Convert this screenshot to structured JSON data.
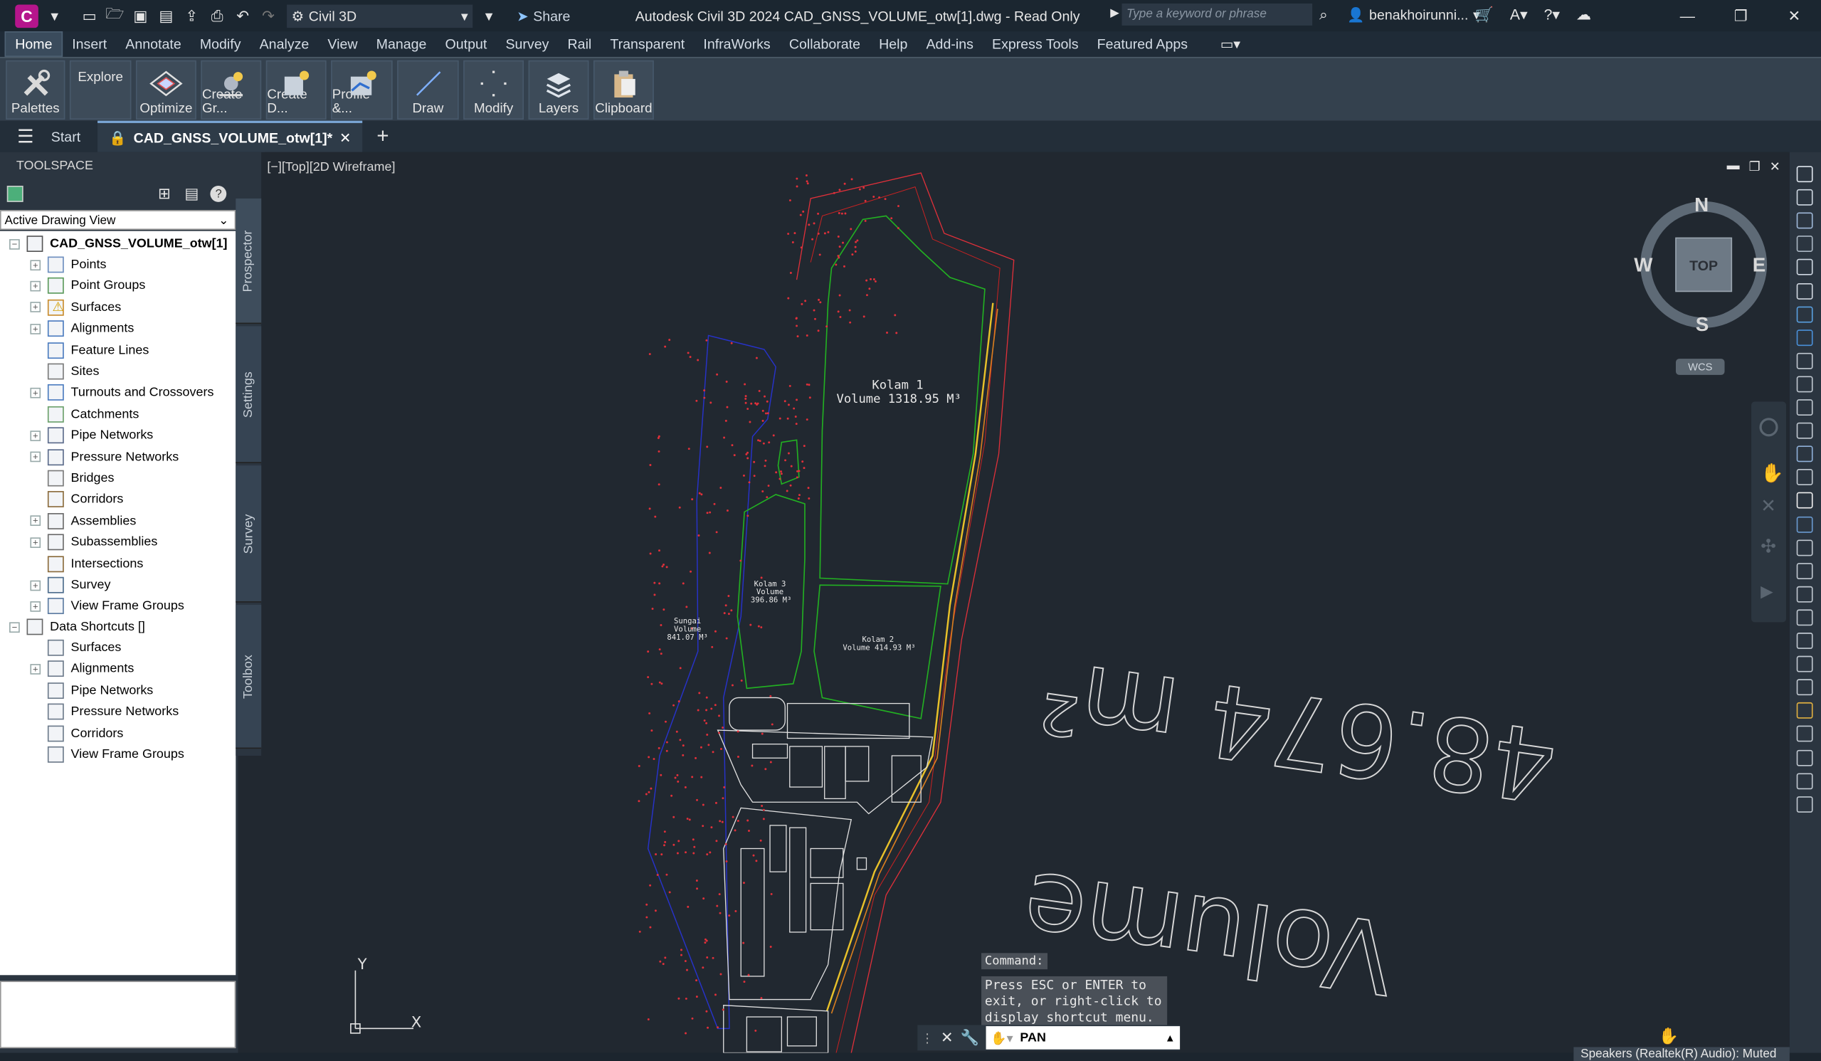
{
  "window": {
    "title": "Autodesk Civil 3D 2024   CAD_GNSS_VOLUME_otw[1].dwg - Read Only",
    "app_letter": "C",
    "workspace": "Civil 3D",
    "share_label": "Share",
    "search_placeholder": "Type a keyword or phrase",
    "user": "benakhoirunni...",
    "accent_color": "#b5158c"
  },
  "ribbon": {
    "tabs": [
      "Home",
      "Insert",
      "Annotate",
      "Modify",
      "Analyze",
      "View",
      "Manage",
      "Output",
      "Survey",
      "Rail",
      "Transparent",
      "InfraWorks",
      "Collaborate",
      "Help",
      "Add-ins",
      "Express Tools",
      "Featured Apps"
    ],
    "active_tab": "Home",
    "buttons": [
      "Palettes",
      "Explore",
      "Optimize",
      "Create Gr...",
      "Create D...",
      "Profile &...",
      "Draw",
      "Modify",
      "Layers",
      "Clipboard"
    ]
  },
  "filetabs": {
    "start": "Start",
    "file": "CAD_GNSS_VOLUME_otw[1]*"
  },
  "toolspace": {
    "title": "TOOLSPACE",
    "view_select": "Active Drawing View",
    "root": "CAD_GNSS_VOLUME_otw[1]",
    "items": [
      "Points",
      "Point Groups",
      "Surfaces",
      "Alignments",
      "Feature Lines",
      "Sites",
      "Turnouts and Crossovers",
      "Catchments",
      "Pipe Networks",
      "Pressure Networks",
      "Bridges",
      "Corridors",
      "Assemblies",
      "Subassemblies",
      "Intersections",
      "Survey",
      "View Frame Groups"
    ],
    "shortcuts_root": "Data Shortcuts []",
    "shortcut_items": [
      "Surfaces",
      "Alignments",
      "Pipe Networks",
      "Pressure Networks",
      "Corridors",
      "View Frame Groups"
    ],
    "side_tabs": [
      "Prospector",
      "Settings",
      "Survey",
      "Toolbox"
    ]
  },
  "viewport": {
    "label": "[−][Top][2D Wireframe]",
    "compass": {
      "n": "N",
      "s": "S",
      "e": "E",
      "w": "W",
      "top": "TOP"
    },
    "wcs": "WCS",
    "kolam1_name": "Kolam 1",
    "kolam1_volume": "Volume 1318.95 M³",
    "kolam2_name": "Kolam 2",
    "kolam2_volume": "Volume 414.93 M³",
    "kolam3_name": "Kolam 3",
    "kolam3_label": "Volume",
    "kolam3_volume": "396.86 M³",
    "sungai_name": "Sungai",
    "sungai_label": "Volume",
    "sungai_volume": "841.07 M³",
    "mirror_text_1": "48.674 m²",
    "mirror_text_2": "Volume",
    "axis_x": "X",
    "axis_y": "Y"
  },
  "command": {
    "label": "Command:",
    "message": "Press ESC or ENTER to exit, or right-click to display shortcut menu.",
    "input": "PAN"
  },
  "status": {
    "toast": "Speakers (Realtek(R) Audio): Muted"
  }
}
